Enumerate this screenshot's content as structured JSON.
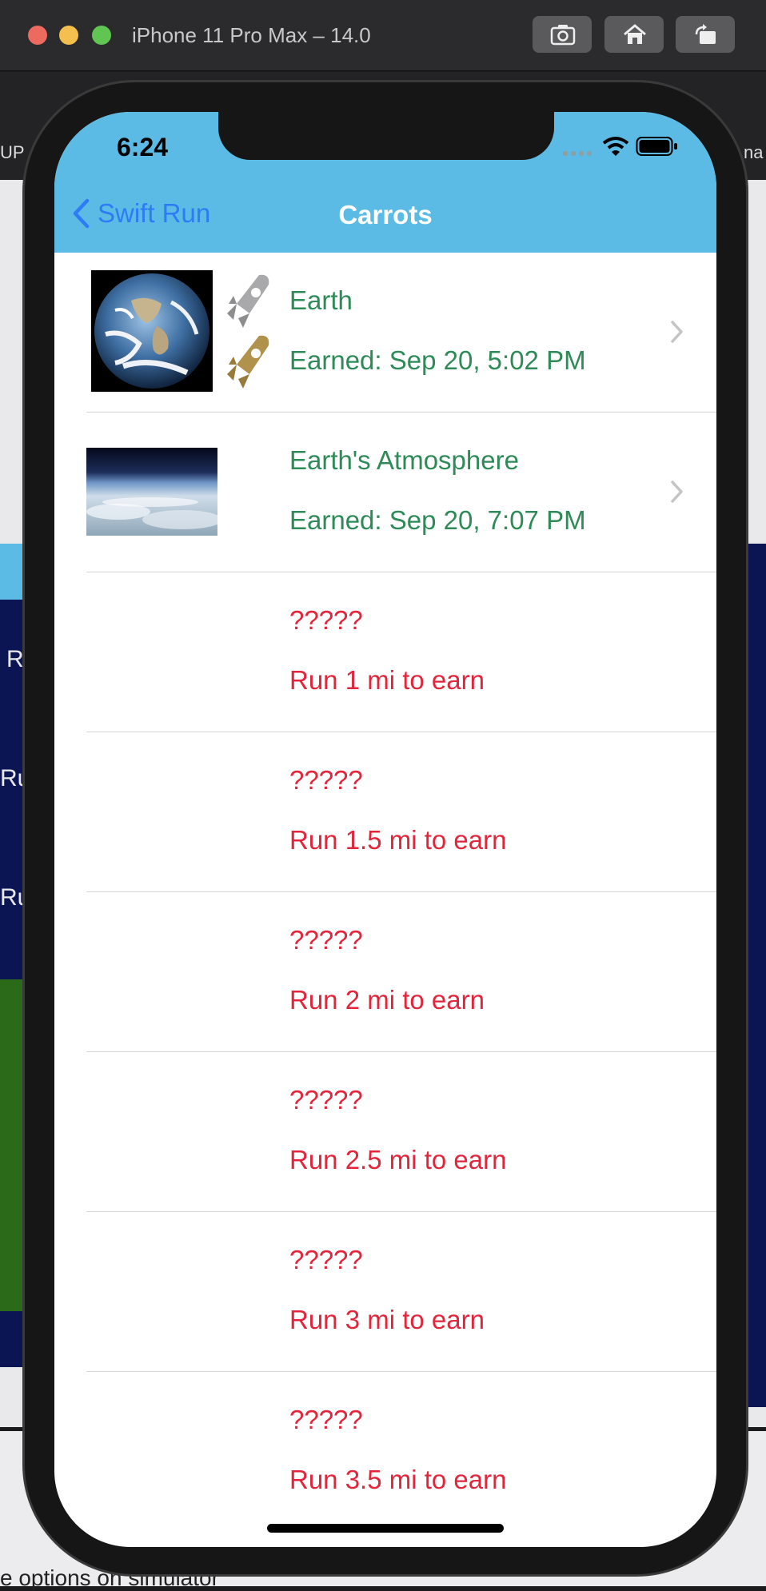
{
  "simulator": {
    "title": "iPhone 11 Pro Max – 14.0",
    "buttons": [
      "screenshot-icon",
      "home-icon",
      "rotate-icon"
    ]
  },
  "background": {
    "left_top_text": "UP",
    "right_top_text": "na",
    "bottom_text": "e options on simulator",
    "side_letters": [
      "R",
      "Ru",
      "Ru"
    ]
  },
  "status_bar": {
    "time": "6:24"
  },
  "nav": {
    "back_label": "Swift Run",
    "title": "Carrots"
  },
  "colors": {
    "header": "#5bbbe4",
    "earned_text": "#2e8b57",
    "locked_text": "#e2253b",
    "back_link": "#2d7cf6"
  },
  "rows": [
    {
      "title": "Earth",
      "subtitle": "Earned: Sep 20, 5:02 PM",
      "earned": true,
      "icon": "earth-photo"
    },
    {
      "title": "Earth's Atmosphere",
      "subtitle": "Earned: Sep 20, 7:07 PM",
      "earned": true,
      "icon": "atmosphere-photo"
    },
    {
      "title": "?????",
      "subtitle": "Run 1 mi to earn",
      "earned": false
    },
    {
      "title": "?????",
      "subtitle": "Run 1.5 mi to earn",
      "earned": false
    },
    {
      "title": "?????",
      "subtitle": "Run 2 mi to earn",
      "earned": false
    },
    {
      "title": "?????",
      "subtitle": "Run 2.5 mi to earn",
      "earned": false
    },
    {
      "title": "?????",
      "subtitle": "Run 3 mi to earn",
      "earned": false
    },
    {
      "title": "?????",
      "subtitle": "Run 3.5 mi to earn",
      "earned": false
    }
  ]
}
